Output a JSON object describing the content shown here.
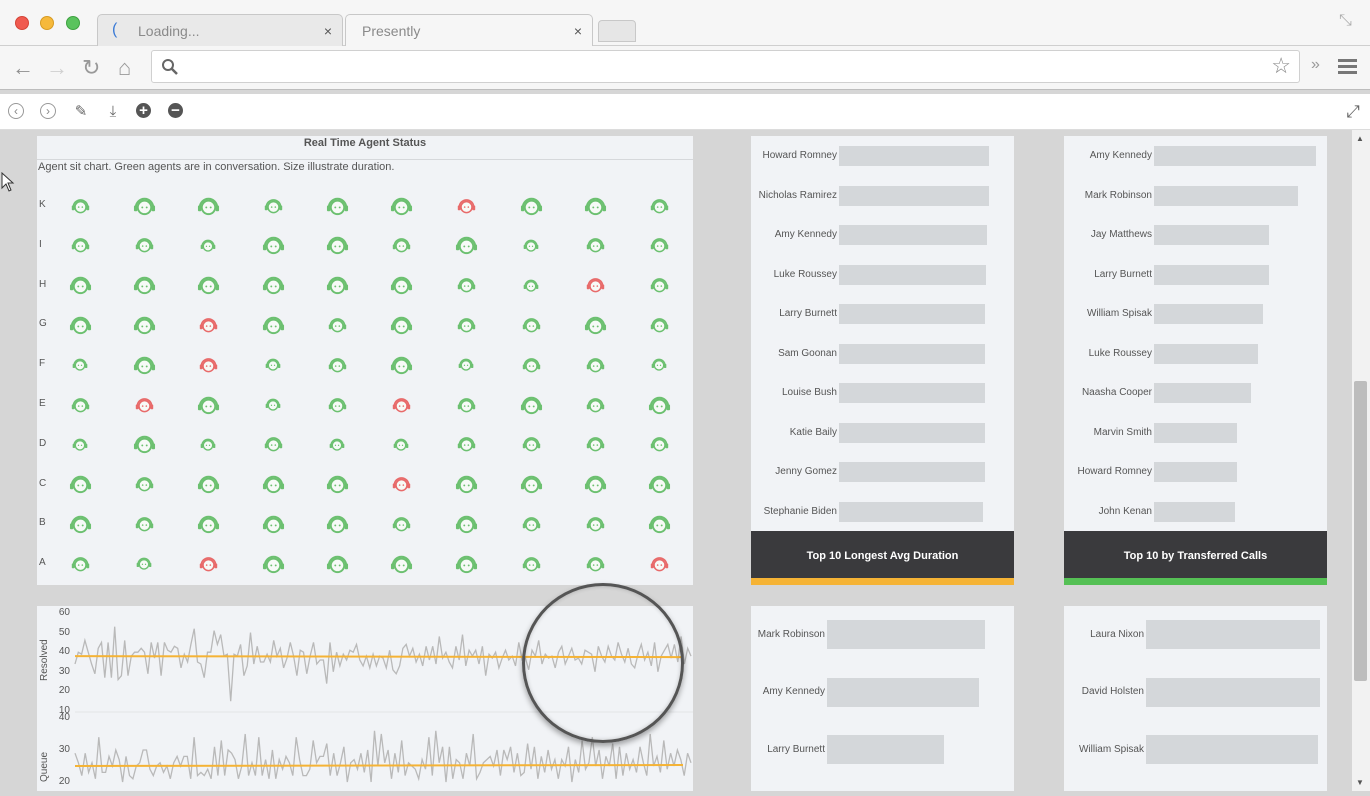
{
  "browser": {
    "tabs": [
      {
        "label": "Loading...",
        "active": false,
        "icon": "loading-spinner-icon"
      },
      {
        "label": "Presently",
        "active": true,
        "icon": ""
      }
    ],
    "address_value": "",
    "icons": {
      "back": "arrow-left-icon",
      "forward": "arrow-right-icon",
      "reload": "reload-icon",
      "home": "home-icon",
      "search": "search-icon",
      "bookmark": "star-icon",
      "overflow": "chevron-double-right-icon",
      "menu": "hamburger-menu-icon",
      "fullscreen": "fullscreen-icon"
    },
    "glyphs": {
      "back": "←",
      "forward": "→",
      "reload": "↻",
      "home": "⌂",
      "close": "×",
      "star": "☆",
      "overflow": "»",
      "menu": "≡"
    }
  },
  "toolbar": {
    "items": [
      {
        "name": "previous-slide-button",
        "icon": "circle-chevron-left-icon",
        "glyph": "‹"
      },
      {
        "name": "next-slide-button",
        "icon": "circle-chevron-right-icon",
        "glyph": "›"
      },
      {
        "name": "edit-button",
        "icon": "pencil-icon",
        "glyph": "✎"
      },
      {
        "name": "download-button",
        "icon": "download-icon",
        "glyph": "⤓"
      },
      {
        "name": "zoom-in-button",
        "icon": "zoom-in-icon",
        "glyph": "+"
      },
      {
        "name": "zoom-out-button",
        "icon": "zoom-out-icon",
        "glyph": "−"
      }
    ],
    "expand_glyph": "⤢"
  },
  "colors": {
    "in_conversation": "#6cc070",
    "idle": "#e86a6a",
    "orange_accent": "#f5b335",
    "green_accent": "#55c055",
    "footer_bg": "#3a3a3d",
    "bar": "#d4d7da",
    "line": "#b9b9b9",
    "avg_line": "#f5b335"
  },
  "agent_chart": {
    "title": "Real Time Agent Status",
    "subtitle": "Agent sit chart. Green agents are in conversation. Size illustrate duration.",
    "rows": [
      "K",
      "I",
      "H",
      "G",
      "F",
      "E",
      "D",
      "C",
      "B",
      "A"
    ],
    "seats": [
      [
        {
          "s": "g",
          "d": 2
        },
        {
          "s": "g",
          "d": 3
        },
        {
          "s": "g",
          "d": 3
        },
        {
          "s": "g",
          "d": 2
        },
        {
          "s": "g",
          "d": 3
        },
        {
          "s": "g",
          "d": 3
        },
        {
          "s": "r",
          "d": 2
        },
        {
          "s": "g",
          "d": 3
        },
        {
          "s": "g",
          "d": 3
        },
        {
          "s": "g",
          "d": 2
        }
      ],
      [
        {
          "s": "g",
          "d": 2
        },
        {
          "s": "g",
          "d": 2
        },
        {
          "s": "g",
          "d": 1
        },
        {
          "s": "g",
          "d": 3
        },
        {
          "s": "g",
          "d": 3
        },
        {
          "s": "g",
          "d": 2
        },
        {
          "s": "g",
          "d": 3
        },
        {
          "s": "g",
          "d": 1
        },
        {
          "s": "g",
          "d": 2
        },
        {
          "s": "g",
          "d": 2
        }
      ],
      [
        {
          "s": "g",
          "d": 3
        },
        {
          "s": "g",
          "d": 3
        },
        {
          "s": "g",
          "d": 3
        },
        {
          "s": "g",
          "d": 3
        },
        {
          "s": "g",
          "d": 3
        },
        {
          "s": "g",
          "d": 3
        },
        {
          "s": "g",
          "d": 2
        },
        {
          "s": "g",
          "d": 1
        },
        {
          "s": "r",
          "d": 2
        },
        {
          "s": "g",
          "d": 2
        }
      ],
      [
        {
          "s": "g",
          "d": 3
        },
        {
          "s": "g",
          "d": 3
        },
        {
          "s": "r",
          "d": 2
        },
        {
          "s": "g",
          "d": 3
        },
        {
          "s": "g",
          "d": 2
        },
        {
          "s": "g",
          "d": 3
        },
        {
          "s": "g",
          "d": 2
        },
        {
          "s": "g",
          "d": 2
        },
        {
          "s": "g",
          "d": 3
        },
        {
          "s": "g",
          "d": 2
        }
      ],
      [
        {
          "s": "g",
          "d": 1
        },
        {
          "s": "g",
          "d": 3
        },
        {
          "s": "r",
          "d": 2
        },
        {
          "s": "g",
          "d": 1
        },
        {
          "s": "g",
          "d": 2
        },
        {
          "s": "g",
          "d": 3
        },
        {
          "s": "g",
          "d": 1
        },
        {
          "s": "g",
          "d": 2
        },
        {
          "s": "g",
          "d": 2
        },
        {
          "s": "g",
          "d": 1
        }
      ],
      [
        {
          "s": "g",
          "d": 2
        },
        {
          "s": "r",
          "d": 2
        },
        {
          "s": "g",
          "d": 3
        },
        {
          "s": "g",
          "d": 1
        },
        {
          "s": "g",
          "d": 2
        },
        {
          "s": "r",
          "d": 2
        },
        {
          "s": "g",
          "d": 2
        },
        {
          "s": "g",
          "d": 3
        },
        {
          "s": "g",
          "d": 2
        },
        {
          "s": "g",
          "d": 3
        }
      ],
      [
        {
          "s": "g",
          "d": 1
        },
        {
          "s": "g",
          "d": 3
        },
        {
          "s": "g",
          "d": 1
        },
        {
          "s": "g",
          "d": 2
        },
        {
          "s": "g",
          "d": 1
        },
        {
          "s": "g",
          "d": 1
        },
        {
          "s": "g",
          "d": 2
        },
        {
          "s": "g",
          "d": 2
        },
        {
          "s": "g",
          "d": 2
        },
        {
          "s": "g",
          "d": 2
        }
      ],
      [
        {
          "s": "g",
          "d": 3
        },
        {
          "s": "g",
          "d": 2
        },
        {
          "s": "g",
          "d": 3
        },
        {
          "s": "g",
          "d": 3
        },
        {
          "s": "g",
          "d": 3
        },
        {
          "s": "r",
          "d": 2
        },
        {
          "s": "g",
          "d": 3
        },
        {
          "s": "g",
          "d": 3
        },
        {
          "s": "g",
          "d": 3
        },
        {
          "s": "g",
          "d": 3
        }
      ],
      [
        {
          "s": "g",
          "d": 3
        },
        {
          "s": "g",
          "d": 2
        },
        {
          "s": "g",
          "d": 3
        },
        {
          "s": "g",
          "d": 3
        },
        {
          "s": "g",
          "d": 3
        },
        {
          "s": "g",
          "d": 2
        },
        {
          "s": "g",
          "d": 3
        },
        {
          "s": "g",
          "d": 2
        },
        {
          "s": "g",
          "d": 2
        },
        {
          "s": "g",
          "d": 3
        }
      ],
      [
        {
          "s": "g",
          "d": 2
        },
        {
          "s": "g",
          "d": 1
        },
        {
          "s": "r",
          "d": 2
        },
        {
          "s": "g",
          "d": 3
        },
        {
          "s": "g",
          "d": 3
        },
        {
          "s": "g",
          "d": 3
        },
        {
          "s": "g",
          "d": 3
        },
        {
          "s": "g",
          "d": 2
        },
        {
          "s": "g",
          "d": 2
        },
        {
          "s": "r",
          "d": 2
        }
      ]
    ]
  },
  "chart_data": [
    {
      "type": "bar",
      "title": "Top 10 Longest Avg Duration",
      "orientation": "horizontal",
      "categories": [
        "Howard Romney",
        "Nicholas Ramirez",
        "Amy Kennedy",
        "Luke Roussey",
        "Larry Burnett",
        "Sam Goonan",
        "Louise Bush",
        "Katie Baily",
        "Jenny Gomez",
        "Stephanie Biden"
      ],
      "values": [
        100,
        100,
        98.5,
        98,
        97.5,
        97,
        97,
        97,
        97,
        96
      ]
    },
    {
      "type": "bar",
      "title": "Top 10 by Transferred Calls",
      "orientation": "horizontal",
      "categories": [
        "Amy Kennedy",
        "Mark Robinson",
        "Jay Matthews",
        "Larry Burnett",
        "William Spisak",
        "Luke Roussey",
        "Naasha Cooper",
        "Marvin Smith",
        "Howard Romney",
        "John Kenan"
      ],
      "values": [
        100,
        89,
        71,
        71,
        67,
        64,
        60,
        51,
        51,
        50
      ]
    },
    {
      "type": "bar",
      "title": "",
      "orientation": "horizontal",
      "categories": [
        "Mark Robinson",
        "Amy Kennedy",
        "Larry Burnett"
      ],
      "values": [
        100,
        96.5,
        74
      ]
    },
    {
      "type": "bar",
      "title": "",
      "orientation": "horizontal",
      "categories": [
        "Laura Nixon",
        "David Holsten",
        "William Spisak"
      ],
      "values": [
        100,
        100,
        99
      ]
    },
    {
      "type": "line",
      "title": "Resolved",
      "ylabel": "Resolved",
      "yticks": [
        10,
        20,
        30,
        40,
        50,
        60
      ],
      "ylim": [
        10,
        60
      ],
      "average": 38,
      "values": [
        34,
        40,
        39,
        46,
        40,
        34,
        29,
        42,
        45,
        27,
        45,
        27,
        53,
        26,
        28,
        46,
        28,
        38,
        40,
        40,
        42,
        40,
        29,
        45,
        37,
        45,
        28,
        45,
        41,
        40,
        43,
        42,
        32,
        39,
        35,
        44,
        52,
        35,
        34,
        27,
        40,
        40,
        51,
        44,
        49,
        38,
        39,
        15,
        39,
        38,
        44,
        28,
        33,
        50,
        34,
        43,
        35,
        35,
        39,
        35,
        46,
        38,
        42,
        32,
        37,
        45,
        38,
        28,
        41,
        40,
        29,
        38,
        45,
        34,
        36,
        36,
        24,
        45,
        30,
        40,
        33,
        39,
        36,
        41,
        40,
        44,
        36,
        33,
        38,
        32,
        39,
        33,
        38,
        37,
        32,
        41,
        31,
        29,
        33,
        42,
        44,
        38,
        42,
        35,
        39,
        33,
        43,
        36,
        43,
        34,
        48,
        37,
        40,
        35,
        32,
        43,
        36,
        49,
        33,
        41,
        38,
        41,
        34,
        43,
        28,
        39,
        37,
        40,
        32,
        37,
        41,
        36,
        38,
        33,
        45,
        36,
        37,
        31,
        41,
        38,
        46,
        34,
        39,
        37,
        38,
        32,
        40,
        43,
        34,
        38,
        42,
        36,
        37,
        34,
        41,
        40,
        39,
        30,
        43,
        38,
        35,
        43,
        38,
        36,
        45,
        39,
        35,
        42,
        34,
        32,
        39,
        44,
        36,
        40,
        33,
        45,
        30,
        38,
        41,
        44,
        37,
        44,
        35,
        48,
        34,
        42,
        38
      ],
      "color": "#b9b9b9"
    },
    {
      "type": "line",
      "title": "Queue",
      "ylabel": "Queue",
      "yticks": [
        20,
        30,
        40
      ],
      "ylim": [
        20,
        40
      ],
      "average": 25,
      "values": [
        29,
        26,
        22,
        29,
        23,
        26,
        21,
        34,
        23,
        23,
        28,
        25,
        30,
        27,
        20,
        28,
        22,
        21,
        25,
        26,
        30,
        30,
        24,
        22,
        25,
        26,
        23,
        25,
        21,
        26,
        28,
        25,
        28,
        28,
        21,
        34,
        22,
        23,
        22,
        24,
        21,
        31,
        22,
        33,
        22,
        30,
        29,
        27,
        21,
        25,
        35,
        22,
        26,
        22,
        34,
        22,
        27,
        21,
        30,
        21,
        27,
        24,
        28,
        26,
        22,
        34,
        27,
        22,
        22,
        24,
        33,
        26,
        28,
        28,
        32,
        22,
        29,
        22,
        26,
        31,
        20,
        26,
        27,
        24,
        29,
        23,
        30,
        20,
        36,
        25,
        35,
        26,
        30,
        21,
        29,
        23,
        33,
        22,
        26,
        25,
        24,
        21,
        27,
        24,
        34,
        22,
        36,
        26,
        31,
        20,
        31,
        21,
        27,
        26,
        21,
        29,
        25,
        35,
        21,
        23,
        26,
        27,
        28,
        25,
        30,
        22,
        30,
        27,
        31,
        23,
        29,
        22,
        23,
        32,
        24,
        31,
        21,
        28,
        23,
        30,
        24,
        27,
        21,
        27,
        25,
        31,
        20,
        27,
        23,
        33,
        24,
        26,
        34,
        25,
        30,
        21,
        28,
        25,
        32,
        21,
        31,
        22,
        29,
        24,
        27,
        23,
        31,
        26,
        22,
        35,
        25,
        28,
        23,
        33,
        24,
        29,
        25,
        30,
        27,
        22,
        29,
        26
      ],
      "color": "#b9b9b9"
    }
  ]
}
